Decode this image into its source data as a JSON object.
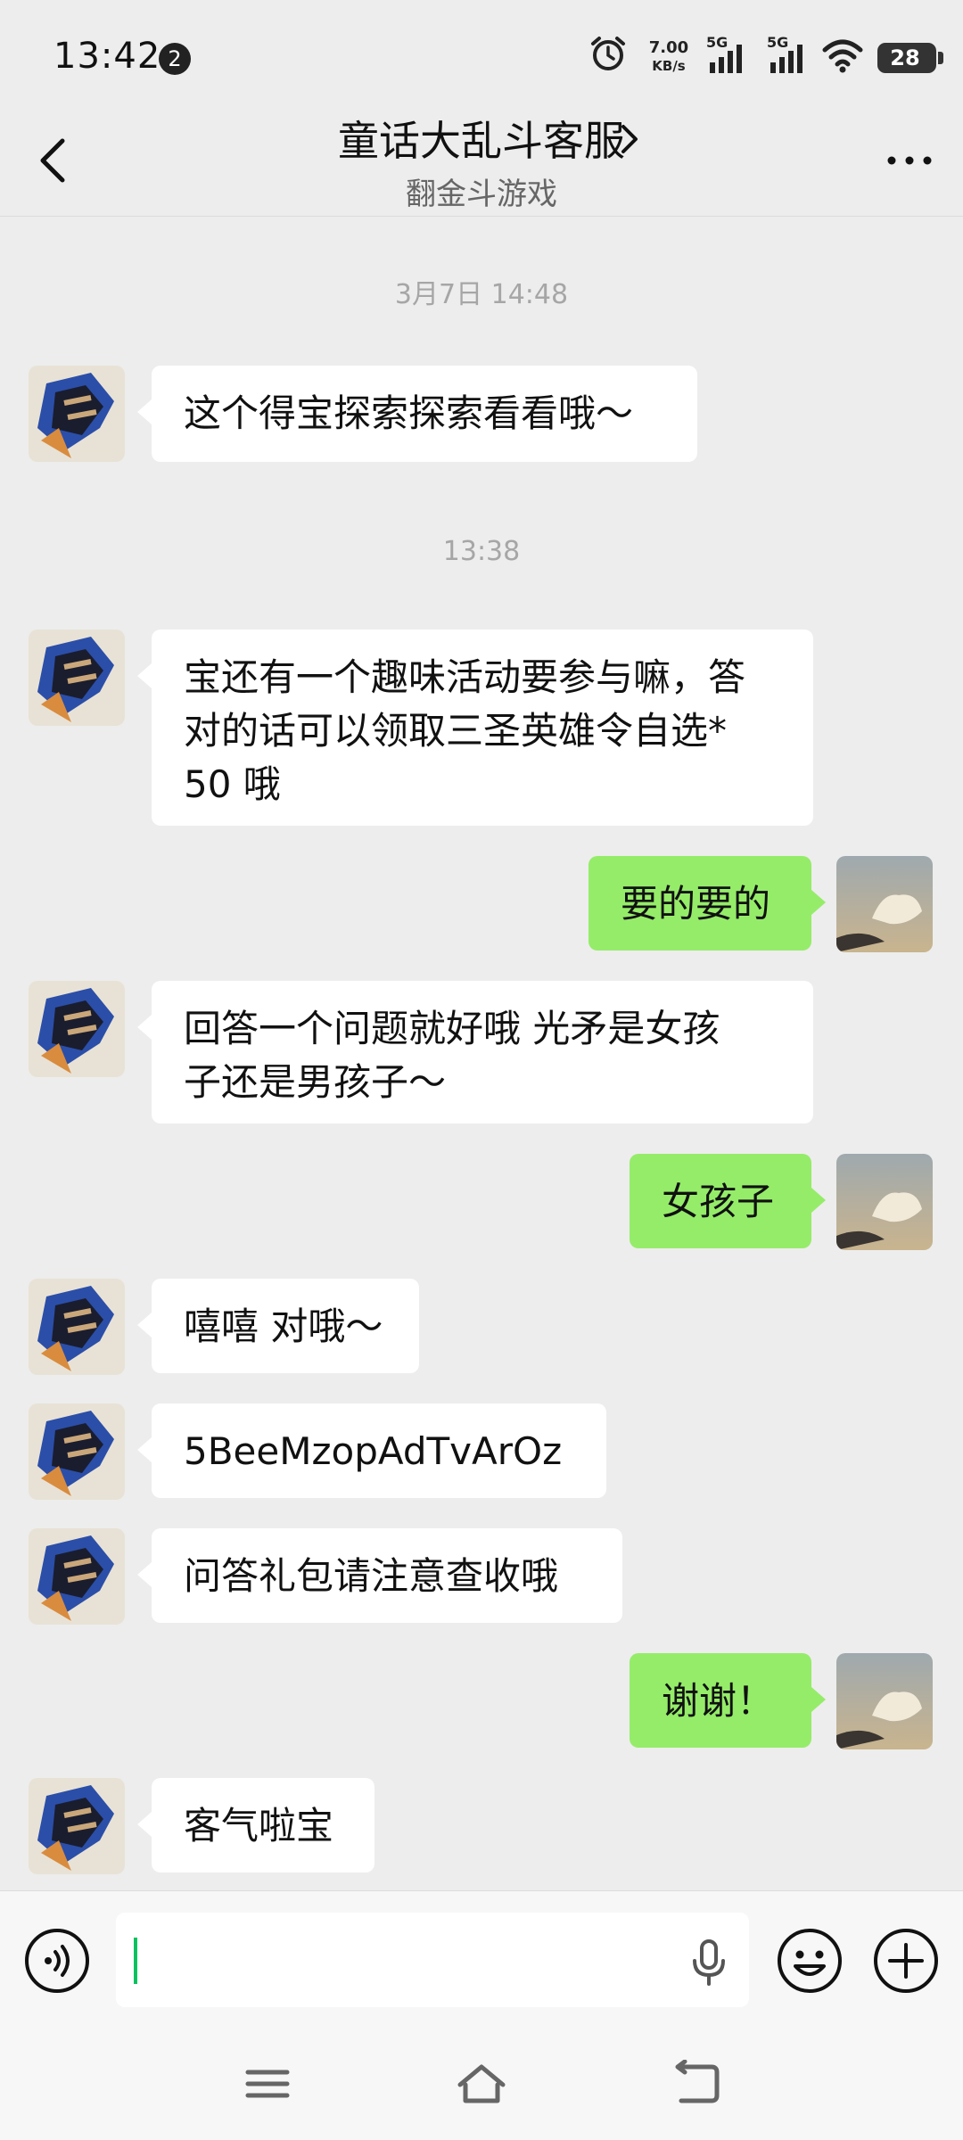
{
  "status_bar": {
    "time": "13:42",
    "notification_count": "2",
    "net_speed": "7.00\nKB/s",
    "net_speed_value": "7.00",
    "net_speed_unit": "KB/s",
    "signal_1": "5G",
    "signal_2": "5G",
    "battery_level": "28"
  },
  "header": {
    "title": "童话大乱斗客服",
    "subtitle": "翻金斗游戏"
  },
  "messages": [
    {
      "type": "timestamp",
      "text": "3月7日 14:48"
    },
    {
      "type": "incoming",
      "text": "这个得宝探索探索看看哦～"
    },
    {
      "type": "timestamp",
      "text": "13:38"
    },
    {
      "type": "incoming",
      "lines": [
        "宝还有一个趣味活动要参与嘛，答",
        "对的话可以领取三圣英雄令自选*",
        "50 哦"
      ]
    },
    {
      "type": "outgoing",
      "text": "要的要的"
    },
    {
      "type": "incoming",
      "lines": [
        "回答一个问题就好哦 光矛是女孩",
        "子还是男孩子～"
      ]
    },
    {
      "type": "outgoing",
      "text": "女孩子"
    },
    {
      "type": "incoming",
      "text": "嘻嘻 对哦～"
    },
    {
      "type": "incoming",
      "text": "5BeeMzopAdTvArOz"
    },
    {
      "type": "incoming",
      "text": "问答礼包请注意查收哦"
    },
    {
      "type": "outgoing",
      "text": "谢谢！"
    },
    {
      "type": "incoming",
      "text": "客气啦宝"
    }
  ],
  "input": {
    "value": ""
  },
  "colors": {
    "background": "#ededed",
    "outgoing_bubble": "#95ec69",
    "incoming_bubble": "#ffffff",
    "caret": "#07c160"
  },
  "icons": [
    "back-icon",
    "chevron-right-icon",
    "more-icon",
    "voice-icon",
    "mic-icon",
    "emoji-icon",
    "plus-icon",
    "menu-icon",
    "home-icon",
    "back-nav-icon",
    "alarm-icon",
    "signal-icon",
    "wifi-icon",
    "battery-icon"
  ]
}
